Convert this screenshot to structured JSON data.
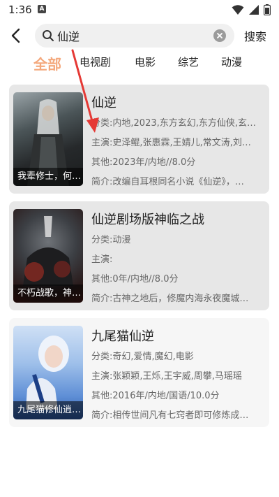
{
  "status": {
    "time": "1:36",
    "app_icon_letter": "A"
  },
  "search": {
    "query": "仙逆",
    "button_label": "搜索"
  },
  "tabs": [
    {
      "label": "全部",
      "active": true
    },
    {
      "label": "电视剧"
    },
    {
      "label": "电影"
    },
    {
      "label": "综艺"
    },
    {
      "label": "动漫"
    }
  ],
  "labels": {
    "genre": "分类:",
    "cast": "主演:",
    "other": "其他:",
    "intro": "简介:"
  },
  "results": [
    {
      "title": "仙逆",
      "poster_caption": "我辈修士，何…",
      "genre": "内地,2023,东方玄幻,东方仙侠,玄…",
      "cast": "史泽鲲,张惠霖,王婧儿,常文涛,刘…",
      "other": "2023年/内地//8.0分",
      "intro": "改编自耳根同名小说《仙逆》，…"
    },
    {
      "title": "仙逆剧场版神临之战",
      "poster_caption": "不朽战歌，神…",
      "genre": "动漫",
      "cast": "",
      "other": "0年/内地//8.0分",
      "intro": "古神之地后，修魔内海永夜魔城…"
    },
    {
      "title": "九尾猫仙逆",
      "poster_caption": "九尾猫修仙逍…",
      "genre": "奇幻,爱情,魔幻,电影",
      "cast": "张颖颖,王烁,王宇威,周攀,马瑶瑶",
      "other": "2016年/内地/国语/10.0分",
      "intro": "相传世间凡有七窍者即可修炼成…"
    }
  ]
}
